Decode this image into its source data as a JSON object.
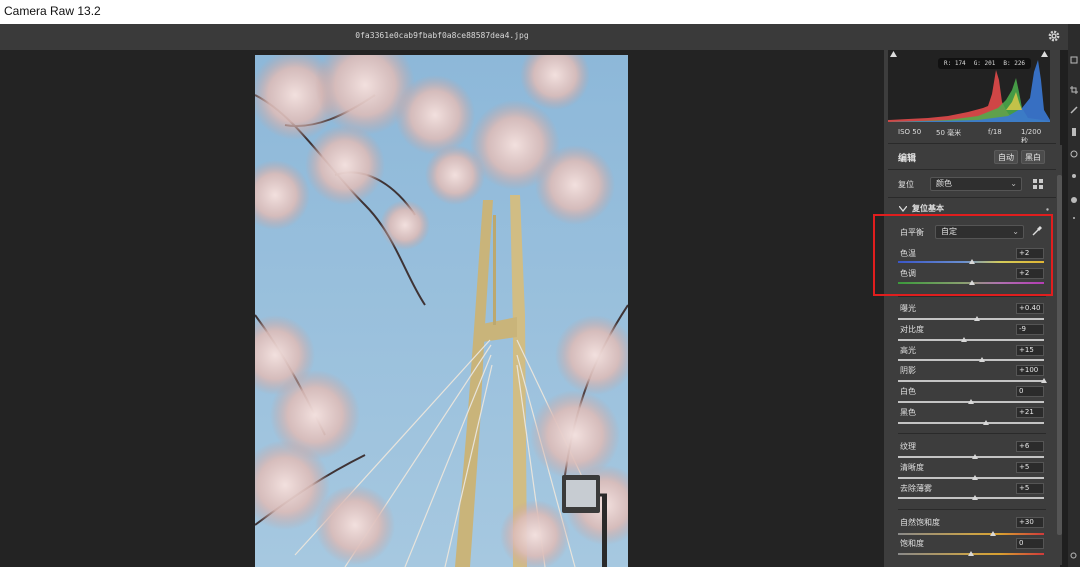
{
  "app": {
    "title": "Camera Raw 13.2"
  },
  "document": {
    "filename": "0fa3361e0cab9fbabf0a8ce88587dea4.jpg"
  },
  "histogram": {
    "readout": {
      "r": "R: 174",
      "g": "G: 201",
      "b": "B: 226"
    }
  },
  "exif": {
    "iso": "ISO 50",
    "focal": "50 毫米",
    "aperture": "f/18",
    "shutter": "1/200 秒"
  },
  "edit": {
    "title": "编辑",
    "auto_button": "自动",
    "bw_button": "黑白",
    "profile_label": "复位",
    "profile_value": "颜色",
    "section_title": "复位基本"
  },
  "white_balance": {
    "label": "白平衡",
    "value": "自定"
  },
  "sliders": [
    {
      "label": "色温",
      "value": "+2",
      "level": 0.51
    },
    {
      "label": "色调",
      "value": "+2",
      "level": 0.51
    },
    {
      "label": "曝光",
      "value": "+0.40",
      "level": 0.54
    },
    {
      "label": "对比度",
      "value": "-9",
      "level": 0.455
    },
    {
      "label": "高光",
      "value": "+15",
      "level": 0.575
    },
    {
      "label": "阴影",
      "value": "+100",
      "level": 1.0
    },
    {
      "label": "白色",
      "value": "0",
      "level": 0.5
    },
    {
      "label": "黑色",
      "value": "+21",
      "level": 0.605
    },
    {
      "label": "纹理",
      "value": "+6",
      "level": 0.53
    },
    {
      "label": "清晰度",
      "value": "+5",
      "level": 0.525
    },
    {
      "label": "去除薄雾",
      "value": "+5",
      "level": 0.525
    },
    {
      "label": "自然饱和度",
      "value": "+30",
      "level": 0.65
    },
    {
      "label": "饱和度",
      "value": "0",
      "level": 0.5
    }
  ],
  "colors": {
    "highlight": "#e01e1e",
    "panel": "#3d3d3d",
    "canvas": "#232323"
  },
  "icons": {
    "settings": "gear-icon",
    "eyedropper": "eyedropper-icon",
    "grid": "profile-browser-icon",
    "chevron": "chevron-down-icon"
  }
}
